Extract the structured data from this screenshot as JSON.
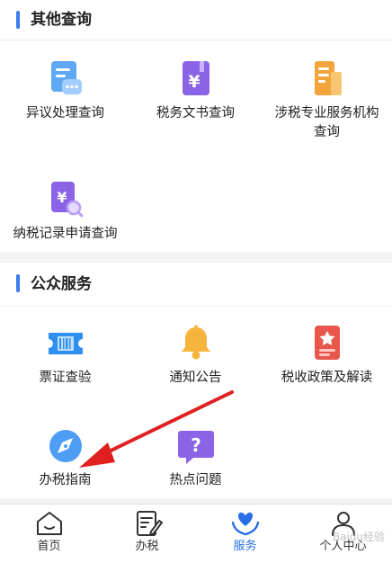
{
  "sections": [
    {
      "title": "其他查询",
      "items": [
        {
          "label": "异议处理查询",
          "icon": "message-doc-icon"
        },
        {
          "label": "税务文书查询",
          "icon": "yen-book-icon"
        },
        {
          "label": "涉税专业服务机构查询",
          "label_line1": "涉税专业服务机构",
          "label_line2": "查询",
          "icon": "building-icon"
        },
        {
          "label": "纳税记录申请查询",
          "icon": "yen-search-icon"
        }
      ]
    },
    {
      "title": "公众服务",
      "items": [
        {
          "label": "票证查验",
          "icon": "ticket-barcode-icon"
        },
        {
          "label": "通知公告",
          "icon": "bell-icon"
        },
        {
          "label": "税收政策及解读",
          "icon": "star-doc-icon"
        },
        {
          "label": "办税指南",
          "icon": "compass-icon"
        },
        {
          "label": "热点问题",
          "icon": "question-chat-icon"
        }
      ]
    }
  ],
  "tabbar": {
    "items": [
      {
        "label": "首页",
        "icon": "home-icon"
      },
      {
        "label": "办税",
        "icon": "edit-doc-icon"
      },
      {
        "label": "服务",
        "icon": "heart-hands-icon",
        "active": true
      },
      {
        "label": "个人中心",
        "icon": "user-icon"
      }
    ]
  },
  "watermark": "Baidu经验",
  "colors": {
    "accent": "#3b7bf0",
    "active_tab": "#2a6ee6",
    "arrow": "#e02020"
  }
}
